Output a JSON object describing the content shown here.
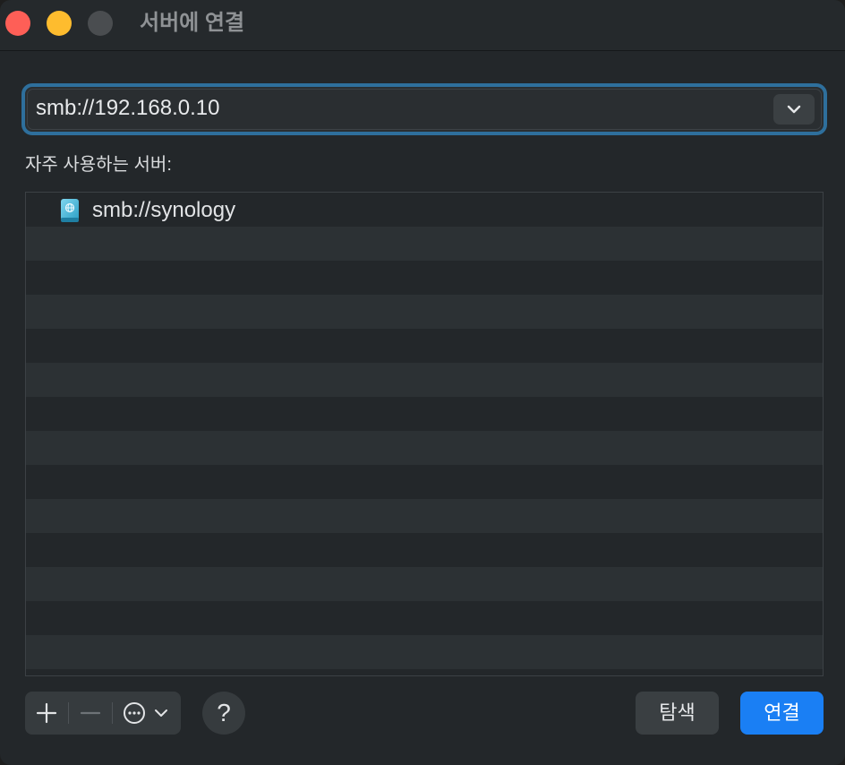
{
  "window": {
    "title": "서버에 연결"
  },
  "url_field": {
    "value": "smb://192.168.0.10"
  },
  "favorites": {
    "label": "자주 사용하는 서버:",
    "items": [
      {
        "label": "smb://synology",
        "icon": "server-icon"
      }
    ]
  },
  "toolbar": {
    "browse_label": "탐색",
    "connect_label": "연결",
    "help_label": "?"
  },
  "colors": {
    "accent": "#1a7ff4",
    "focus_ring": "#2e6f9c",
    "close": "#fe5f57",
    "minimize": "#febc2e"
  }
}
